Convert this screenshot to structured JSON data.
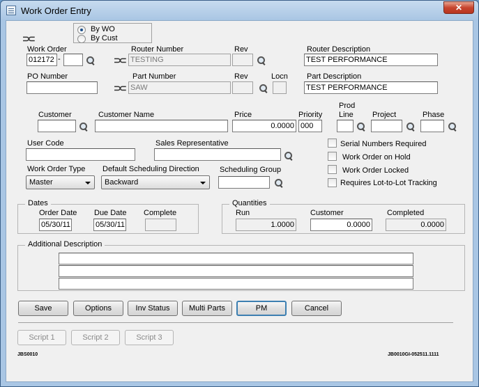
{
  "window": {
    "title": "Work Order Entry",
    "close_glyph": "✕"
  },
  "mode": {
    "by_wo": "By WO",
    "by_cust": "By Cust"
  },
  "labels": {
    "work_order": "Work Order",
    "router_number": "Router Number",
    "rev": "Rev",
    "router_description": "Router Description",
    "po_number": "PO Number",
    "part_number": "Part Number",
    "rev2": "Rev",
    "locn": "Locn",
    "part_description": "Part Description",
    "customer": "Customer",
    "customer_name": "Customer Name",
    "price": "Price",
    "priority": "Priority",
    "prod_line_1": "Prod",
    "prod_line_2": "Line",
    "project": "Project",
    "phase": "Phase",
    "user_code": "User Code",
    "sales_rep": "Sales Representative",
    "work_order_type": "Work Order Type",
    "default_sched_dir": "Default Scheduling Direction",
    "sched_group": "Scheduling Group"
  },
  "values": {
    "work_order": "012172",
    "wo_dash": "-",
    "wo_suffix": "",
    "router_number": "TESTING",
    "router_rev": "",
    "router_description": "TEST PERFORMANCE",
    "po_number": "",
    "part_number": "SAW",
    "part_rev": "",
    "locn": "",
    "part_description": "TEST PERFORMANCE",
    "customer": "",
    "customer_name": "",
    "price": "0.0000",
    "priority": "000",
    "prod_line": "",
    "project": "",
    "phase": "",
    "user_code": "",
    "sales_rep": "",
    "work_order_type": "Master",
    "default_sched_dir": "Backward",
    "sched_group": ""
  },
  "checkboxes": {
    "serial": "Serial Numbers Required",
    "hold": "Work Order on Hold",
    "locked": "Work Order Locked",
    "lot": "Requires Lot-to-Lot Tracking"
  },
  "dates": {
    "title": "Dates",
    "order_label": "Order Date",
    "due_label": "Due Date",
    "complete_label": "Complete",
    "order": "05/30/11",
    "due": "05/30/11",
    "complete": ""
  },
  "quantities": {
    "title": "Quantities",
    "run_label": "Run",
    "customer_label": "Customer",
    "completed_label": "Completed",
    "run": "1.0000",
    "customer": "0.0000",
    "completed": "0.0000"
  },
  "additional": {
    "title": "Additional Description",
    "line1": "",
    "line2": "",
    "line3": ""
  },
  "buttons": {
    "save": "Save",
    "options": "Options",
    "inv_status": "Inv Status",
    "multi_parts": "Multi Parts",
    "pm": "PM",
    "cancel": "Cancel"
  },
  "scripts": {
    "s1": "Script 1",
    "s2": "Script 2",
    "s3": "Script 3"
  },
  "footer": {
    "left": "JBS0010",
    "right": "JB0010GI-052511.1111"
  }
}
